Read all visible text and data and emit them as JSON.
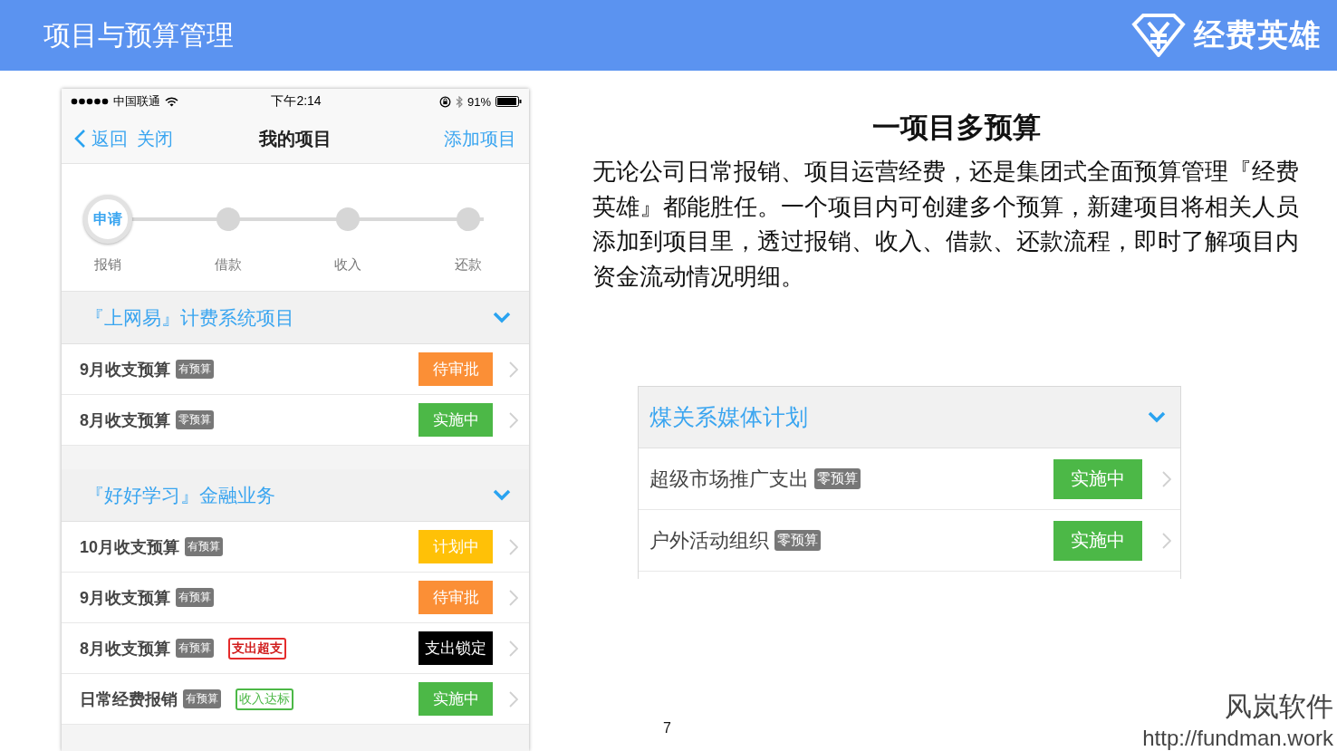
{
  "header": {
    "title": "项目与预算管理",
    "brand": "经费英雄"
  },
  "phone": {
    "status_bar": {
      "carrier": "中国联通",
      "time": "下午2:14",
      "battery": "91%"
    },
    "nav": {
      "back": "返回",
      "close": "关闭",
      "title": "我的项目",
      "action": "添加项目"
    },
    "steps": [
      {
        "bubble": "申请",
        "label": "报销",
        "selected": true
      },
      {
        "label": "借款",
        "selected": false
      },
      {
        "label": "收入",
        "selected": false
      },
      {
        "label": "还款",
        "selected": false
      }
    ],
    "groups": [
      {
        "title": "『上网易』计费系统项目",
        "expanded": true,
        "rows": [
          {
            "name": "9月收支预算",
            "tag": "有预算",
            "status": {
              "label": "待审批",
              "kind": "pending"
            }
          },
          {
            "name": "8月收支预算",
            "tag": "零预算",
            "status": {
              "label": "实施中",
              "kind": "active"
            }
          }
        ]
      },
      {
        "title": "『好好学习』金融业务",
        "expanded": true,
        "rows": [
          {
            "name": "10月收支预算",
            "tag": "有预算",
            "status": {
              "label": "计划中",
              "kind": "planned"
            }
          },
          {
            "name": "9月收支预算",
            "tag": "有预算",
            "status": {
              "label": "待审批",
              "kind": "pending"
            }
          },
          {
            "name": "8月收支预算",
            "tag": "有预算",
            "flag": {
              "label": "支出超支",
              "kind": "over"
            },
            "status": {
              "label": "支出锁定",
              "kind": "locked"
            }
          },
          {
            "name": "日常经费报销",
            "tag": "有预算",
            "flag": {
              "label": "收入达标",
              "kind": "income"
            },
            "status": {
              "label": "实施中",
              "kind": "active"
            }
          }
        ]
      }
    ]
  },
  "heading": "一项目多预算",
  "paragraph": "无论公司日常报销、项目运营经费，还是集团式全面预算管理『经费英雄』都能胜任。一个项目内可创建多个预算，新建项目将相关人员添加到项目里，透过报销、收入、借款、还款流程，即时了解项目内资金流动情况明细。",
  "example": {
    "title": "煤关系媒体计划",
    "expanded": true,
    "rows": [
      {
        "name": "超级市场推广支出",
        "tag": "零预算",
        "status": {
          "label": "实施中",
          "kind": "active"
        }
      },
      {
        "name": "户外活动组织",
        "tag": "零预算",
        "status": {
          "label": "实施中",
          "kind": "active"
        }
      }
    ]
  },
  "page_number": "7",
  "footer": {
    "company": "风岚软件",
    "url": "http://fundman.work"
  }
}
